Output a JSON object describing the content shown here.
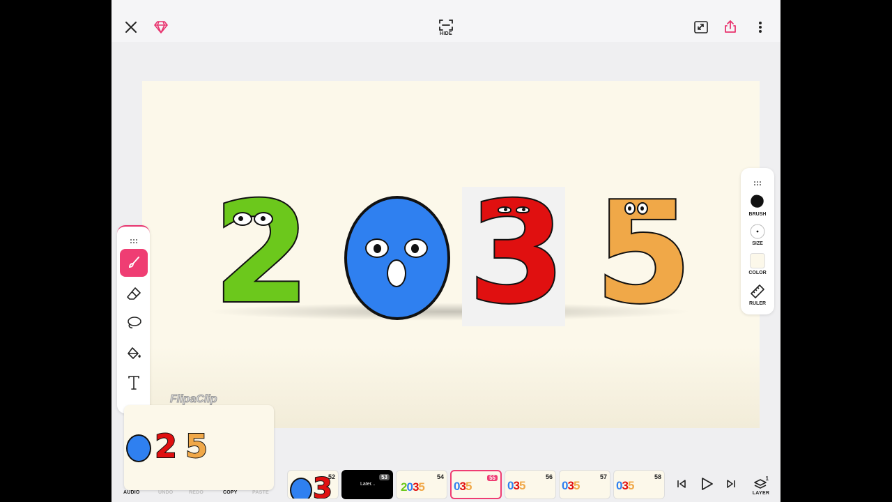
{
  "header": {
    "hide_label": "HIDE",
    "icons": [
      "close-icon",
      "premium-gem-icon",
      "hide-toolbar-icon",
      "fullscreen-icon",
      "share-icon",
      "more-icon"
    ]
  },
  "left_tools": [
    "brush-tool-icon",
    "eraser-tool-icon",
    "lasso-tool-icon",
    "fill-bucket-tool-icon",
    "text-tool-icon"
  ],
  "right_panel": {
    "brush": "BRUSH",
    "size": "SIZE",
    "color": "COLOR",
    "ruler": "RULER"
  },
  "canvas": {
    "digits": [
      "2",
      "0",
      "3",
      "5"
    ],
    "watermark": "FlipaClip"
  },
  "preview": {
    "digits": [
      "0",
      "2",
      "5"
    ]
  },
  "bottom_bar": {
    "audio": "AUDIO",
    "undo": "UNDO",
    "redo": "REDO",
    "copy": "COPY",
    "paste": "PASTE",
    "layer": "LAYER",
    "layer_count": "1"
  },
  "frames": [
    {
      "num": "52",
      "text": ""
    },
    {
      "num": "53",
      "text": "Later..."
    },
    {
      "num": "54",
      "text": ""
    },
    {
      "num": "55",
      "text": ""
    },
    {
      "num": "56",
      "text": ""
    },
    {
      "num": "57",
      "text": ""
    },
    {
      "num": "58",
      "text": ""
    }
  ],
  "colors": {
    "accent": "#ef3d73",
    "canvas_bg": "#fcf8ea",
    "digit_2": "#6cc81c",
    "digit_0": "#2f80f0",
    "digit_3": "#e01010",
    "digit_5": "#f0a848"
  }
}
